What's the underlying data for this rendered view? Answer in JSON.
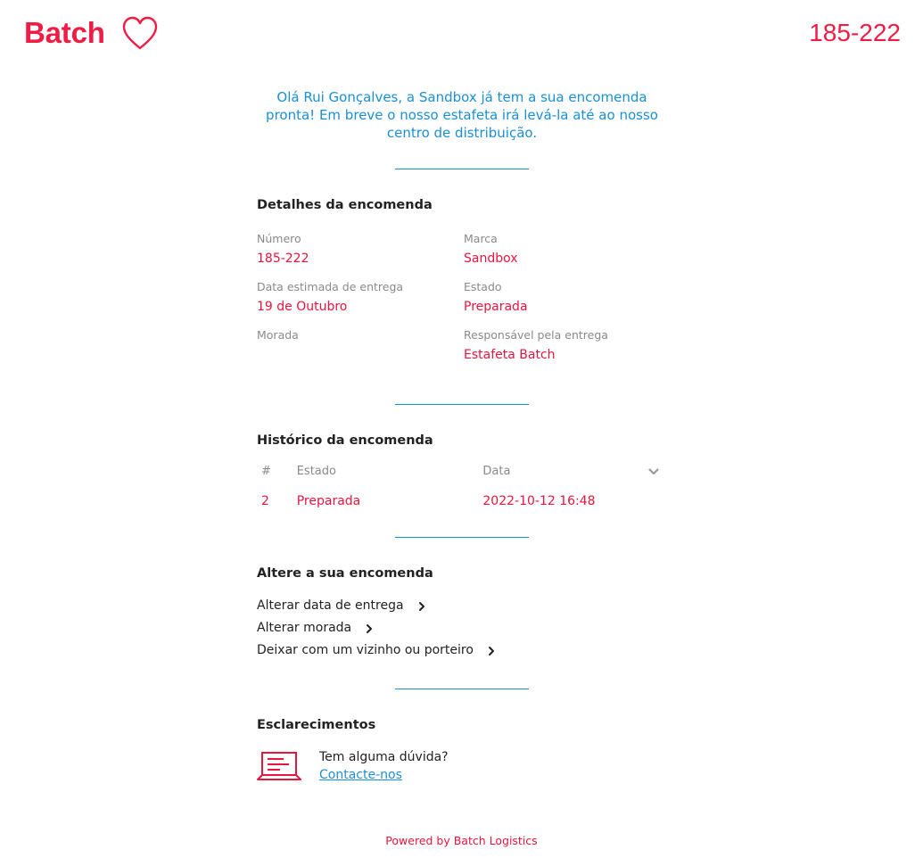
{
  "brand": {
    "name": "Batch",
    "color": "#f01c44"
  },
  "header": {
    "order_number": "185-222"
  },
  "intro_message": "Olá Rui Gonçalves, a Sandbox já tem a sua encomenda pronta! Em breve o nosso estafeta irá levá-la até ao nosso centro de distribuição.",
  "details": {
    "title": "Detalhes da encomenda",
    "fields": [
      {
        "label": "Número",
        "value": "185-222"
      },
      {
        "label": "Marca",
        "value": "Sandbox"
      },
      {
        "label": "Data estimada de entrega",
        "value": "19 de Outubro"
      },
      {
        "label": "Estado",
        "value": "Preparada"
      },
      {
        "label": "Morada",
        "value": ""
      },
      {
        "label": "Responsável pela entrega",
        "value": "Estafeta Batch"
      }
    ]
  },
  "history": {
    "title": "Histórico da encomenda",
    "columns": [
      "#",
      "Estado",
      "Data"
    ],
    "rows": [
      {
        "num": "2",
        "estado": "Preparada",
        "data": "2022-10-12 16:48"
      }
    ],
    "toggle_icon": "chevron-down-icon"
  },
  "change": {
    "title": "Altere a sua encomenda",
    "options": [
      {
        "label": "Alterar data de entrega"
      },
      {
        "label": "Alterar morada"
      },
      {
        "label": "Deixar com um vizinho ou porteiro"
      }
    ]
  },
  "help": {
    "title": "Esclarecimentos",
    "question": "Tem alguma dúvida?",
    "link_label": "Contacte-nos",
    "icon": "laptop-icon"
  },
  "footer": {
    "powered_by": "Powered by Batch Logistics"
  },
  "colors": {
    "accent_red": "#e8163c",
    "accent_blue": "#1b8fd6",
    "text_dark": "#222222",
    "label_grey": "#8a8a8a"
  }
}
